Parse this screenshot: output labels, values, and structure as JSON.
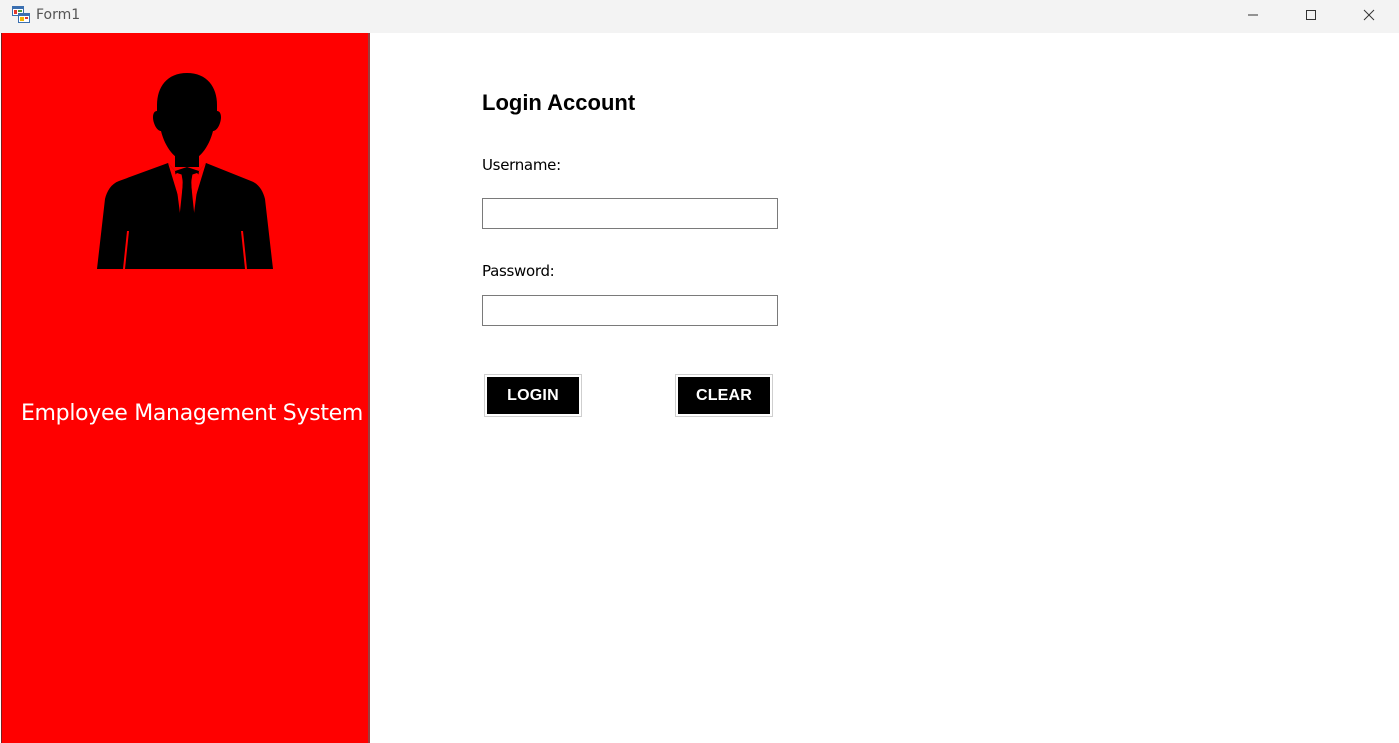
{
  "window": {
    "title": "Form1",
    "controls": {
      "minimize": "minimize-icon",
      "maximize": "maximize-icon",
      "close": "close-icon"
    }
  },
  "sidebar": {
    "background_color": "#ff0000",
    "avatar_icon": "business-person-icon",
    "system_title": "Employee Management System"
  },
  "login_form": {
    "heading": "Login Account",
    "username_label": "Username:",
    "username_value": "",
    "password_label": "Password:",
    "password_value": "",
    "login_button": "LOGIN",
    "clear_button": "CLEAR"
  },
  "colors": {
    "accent": "#ff0000",
    "button_background": "#000000",
    "button_text": "#ffffff"
  }
}
